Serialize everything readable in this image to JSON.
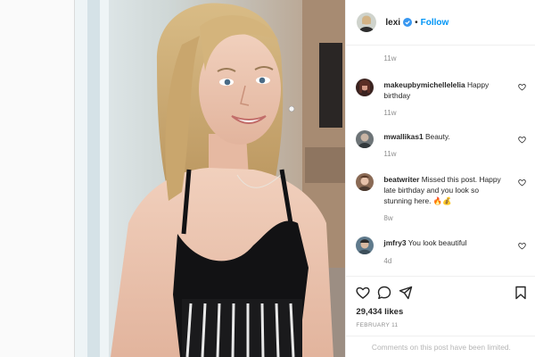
{
  "post": {
    "author": "lexi",
    "verified": true,
    "separator": "•",
    "follow_label": "Follow",
    "first_time": "11w",
    "likes": "29,434 likes",
    "date": "FEBRUARY 11",
    "comments_limited": "Comments on this post have been limited."
  },
  "comments": [
    {
      "user": "makeupbymichellelelia",
      "text": "Happy birthday",
      "time": "11w"
    },
    {
      "user": "mwallikas1",
      "text": "Beauty.",
      "time": "11w"
    },
    {
      "user": "beatwriter",
      "text": "Missed this post. Happy late birthday and you look so stunning here. 🔥💰",
      "time": "8w"
    },
    {
      "user": "jmfry3",
      "text": "You look beautiful",
      "time": "4d"
    }
  ],
  "icons": {
    "verified": "verified-badge-icon",
    "like": "heart-icon",
    "comment": "comment-bubble-icon",
    "share": "paper-plane-icon",
    "save": "bookmark-icon"
  },
  "colors": {
    "link": "#0095f6",
    "verified": "#3897f0",
    "text": "#262626",
    "muted": "#8e8e8e",
    "border": "#efefef"
  }
}
